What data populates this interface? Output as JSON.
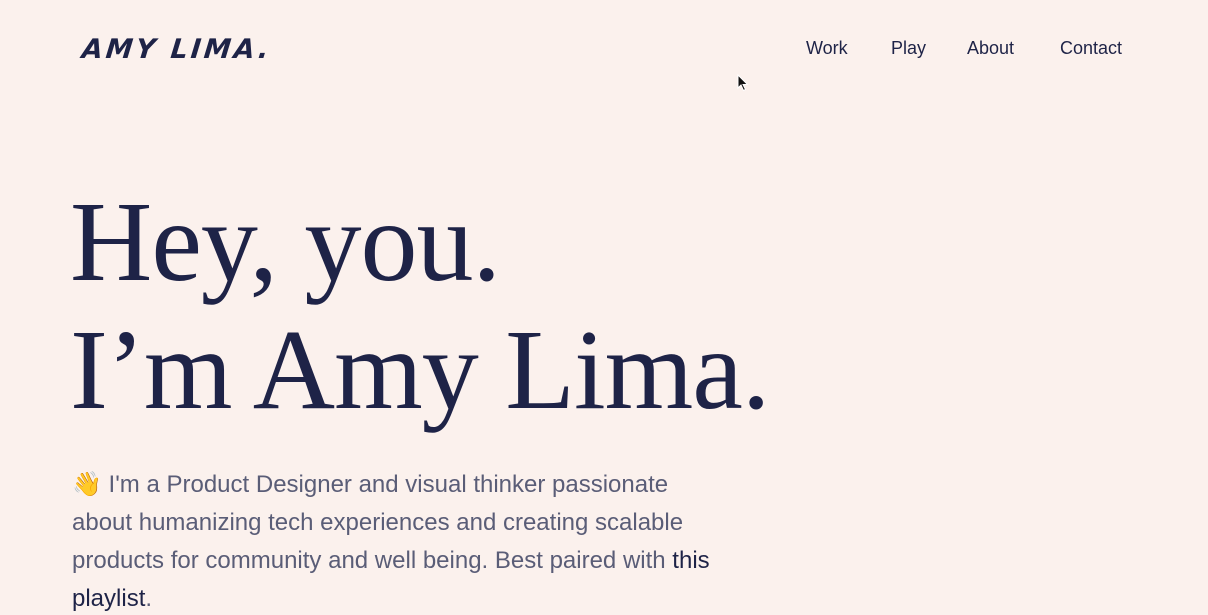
{
  "header": {
    "logo": "AMY LIMA.",
    "nav": [
      {
        "label": "Work"
      },
      {
        "label": "Play"
      },
      {
        "label": "About"
      },
      {
        "label": "Contact"
      }
    ]
  },
  "hero": {
    "title_line1": "Hey, you.",
    "title_line2": "I’m Amy Lima.",
    "wave_emoji": "👋",
    "intro_text": " I'm a Product Designer and visual thinker passionate about humanizing tech experiences and creating scalable products for community and well being. Best paired with ",
    "playlist_link": "this playlist",
    "intro_end": "."
  },
  "colors": {
    "background": "#fbf1ed",
    "primary": "#1e2347",
    "body_text": "#5a5d77"
  },
  "icons": {
    "cursor": "mouse-pointer-icon"
  }
}
